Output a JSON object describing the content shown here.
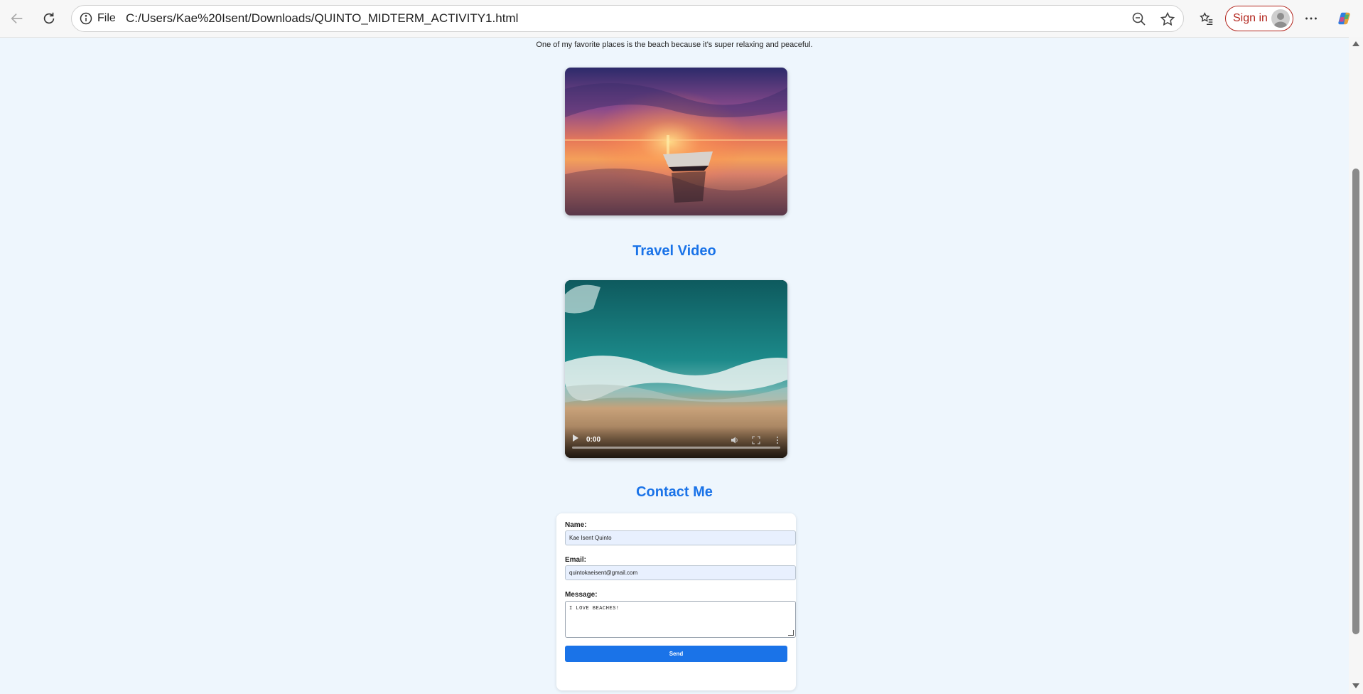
{
  "browser": {
    "address_scheme_label": "File",
    "url": "C:/Users/Kae%20Isent/Downloads/QUINTO_MIDTERM_ACTIVITY1.html",
    "signin_label": "Sign in"
  },
  "page": {
    "intro_text": "One of my favorite places is the beach because it's super relaxing and peaceful.",
    "travel_video_title": "Travel Video",
    "video_time": "0:00",
    "video_progress": 0,
    "contact_title": "Contact Me",
    "form": {
      "name_label": "Name:",
      "name_value": "Kae Isent Quinto",
      "email_label": "Email:",
      "email_value": "quintokaeisent@gmail.com",
      "message_label": "Message:",
      "message_value": "I LOVE BEACHES!",
      "send_label": "Send"
    }
  },
  "colors": {
    "page_background": "#eef6fd",
    "heading_blue": "#1a73e8",
    "button_blue": "#1a73e8",
    "signin_red": "#b3261e"
  },
  "icons": [
    "back-arrow-icon",
    "reload-icon",
    "info-icon",
    "zoom-out-icon",
    "favorite-star-icon",
    "favorites-list-icon",
    "profile-avatar-icon",
    "more-options-icon",
    "copilot-icon",
    "play-icon",
    "volume-icon",
    "fullscreen-icon",
    "video-menu-icon"
  ]
}
